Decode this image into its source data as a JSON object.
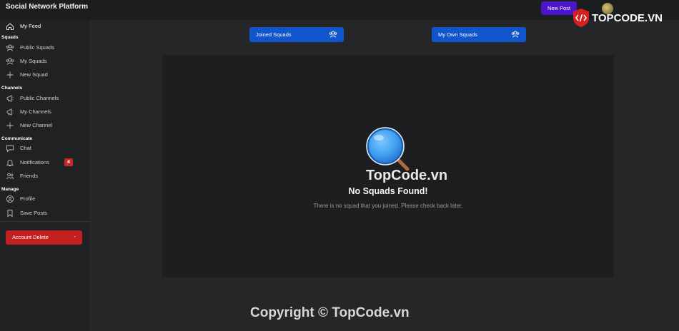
{
  "app": {
    "title": "Social Network Platform",
    "new_post": "New Post"
  },
  "sidebar": {
    "my_feed": "My Feed",
    "sections": {
      "squads": "Squads",
      "channels": "Channels",
      "communicate": "Communicate",
      "manage": "Manage"
    },
    "items": {
      "public_squads": "Public Squads",
      "my_squads": "My Squads",
      "new_squad": "New Squad",
      "public_channels": "Public Channels",
      "my_channels": "My Channels",
      "new_channel": "New Channel",
      "chat": "Chat",
      "notifications": "Notifications",
      "notifications_count": "4",
      "friends": "Friends",
      "profile": "Profile",
      "save_posts": "Save Posts"
    },
    "account_delete": "Account Delete",
    "account_delete_icon": "-"
  },
  "tabs": {
    "joined": "Joined Squads",
    "own": "My Own Squads"
  },
  "empty_state": {
    "icon": "magnifier-icon",
    "title": "No Squads Found!",
    "message": "There is no squad that you joined. Please check back later."
  },
  "watermark": {
    "logo_text": "TOPCODE.VN",
    "center_text": "TopCode.vn",
    "copyright": "Copyright © TopCode.vn"
  },
  "colors": {
    "accent_blue": "#1155cc",
    "accent_purple": "#4a16c8",
    "danger": "#c21f1f",
    "background": "#242628",
    "sidebar": "#1f2123"
  }
}
